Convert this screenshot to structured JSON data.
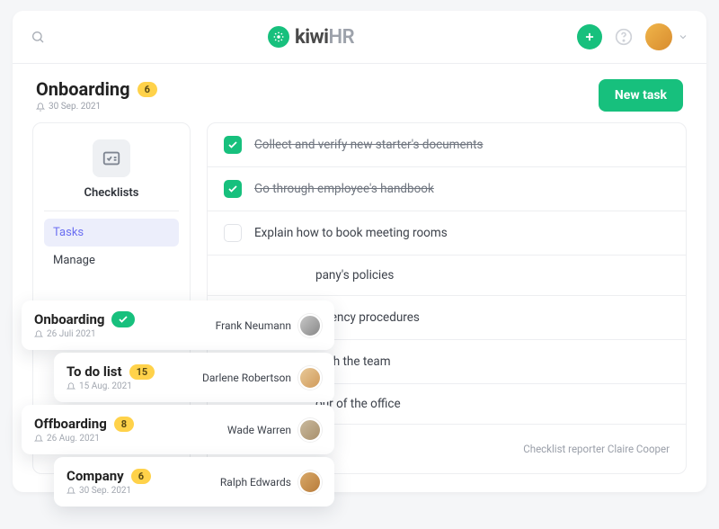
{
  "brand": {
    "name": "kiwi",
    "suffix": "HR"
  },
  "header": {
    "title": "Onboarding",
    "count": "6",
    "date": "30 Sep. 2021",
    "new_task_label": "New task"
  },
  "sidebar": {
    "title": "Checklists",
    "items": [
      {
        "label": "Tasks",
        "active": true
      },
      {
        "label": "Manage",
        "active": false
      }
    ]
  },
  "tasks": [
    {
      "text": "Collect and verify new starter's documents",
      "done": true
    },
    {
      "text": "Go through employee's handbook",
      "done": true
    },
    {
      "text": "Explain how to book meeting rooms",
      "done": false
    },
    {
      "text": "pany's policies",
      "done": false
    },
    {
      "text": "Explain emergency procedures",
      "done": false
    },
    {
      "text": "Have lunch with the team",
      "done": false
    },
    {
      "text": "our of the office",
      "done": false
    }
  ],
  "reporter": {
    "label": "Checklist reporter",
    "name": "Claire Cooper"
  },
  "overlays": [
    {
      "title": "Onboarding",
      "badge_type": "check",
      "date": "26 Juli 2021",
      "reporter": "Frank Neumann",
      "avatar": "a"
    },
    {
      "title": "To do list",
      "badge_type": "count",
      "badge": "15",
      "date": "15 Aug. 2021",
      "reporter": "Darlene Robertson",
      "avatar": "b"
    },
    {
      "title": "Offboarding",
      "badge_type": "count",
      "badge": "8",
      "date": "26 Aug. 2021",
      "reporter": "Wade Warren",
      "avatar": "c"
    },
    {
      "title": "Company",
      "badge_type": "count",
      "badge": "6",
      "date": "30 Sep. 2021",
      "reporter": "Ralph Edwards",
      "avatar": "d"
    }
  ]
}
